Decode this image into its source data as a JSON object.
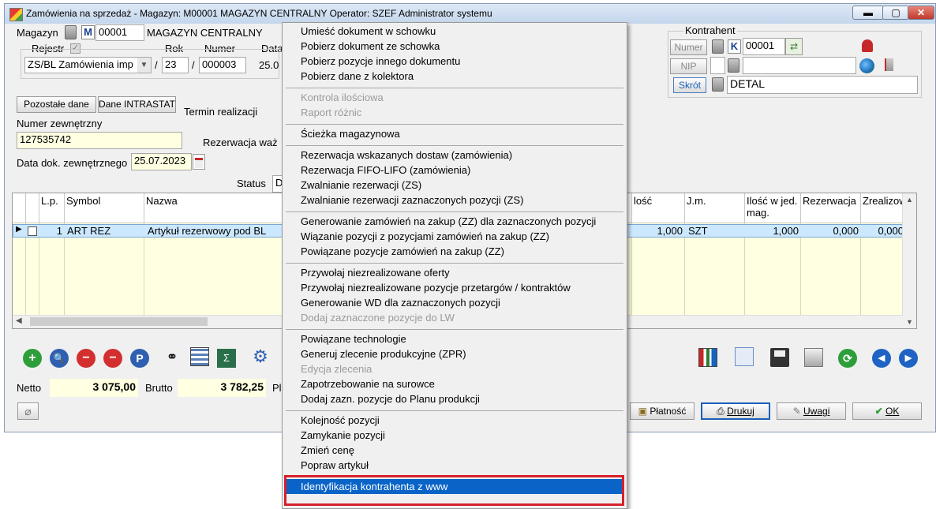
{
  "window": {
    "title": "Zamówienia na sprzedaż - Magazyn: M00001 MAGAZYN CENTRALNY  Operator: SZEF Administrator systemu"
  },
  "header": {
    "magazyn_label": "Magazyn",
    "magazyn_code_prefix": "M",
    "magazyn_code": "00001",
    "magazyn_name": "MAGAZYN CENTRALNY",
    "rejestr_label": "Rejestr",
    "rok_label": "Rok",
    "numer_label": "Numer",
    "data_label": "Data",
    "rejestr_value": "ZS/BL Zamówienia imp",
    "slash1": "/",
    "rok_value": "23",
    "slash2": "/",
    "numer_value": "000003",
    "data_value": "25.0"
  },
  "tabs": {
    "pozostale": "Pozostałe dane",
    "intrastat": "Dane INTRASTAT"
  },
  "termin_label": "Termin realizacji",
  "numer_zewn_label": "Numer zewnętrzny",
  "numer_zewn_value": "127535742",
  "rezerwacja_label": "Rezerwacja  waż",
  "data_dok_label": "Data dok. zewnętrznego",
  "data_dok_value": "25.07.2023",
  "status_label": "Status",
  "status_value": "D",
  "kontrahent": {
    "group_label": "Kontrahent",
    "numer_btn": "Numer",
    "nip_btn": "NIP",
    "skrot_btn": "Skrót",
    "code_prefix": "K",
    "code": "00001",
    "skrot_value": "DETAL"
  },
  "grid": {
    "headers": {
      "lp": "L.p.",
      "symbol": "Symbol",
      "nazwa": "Nazwa",
      "ilosc": "lość",
      "jm": "J.m.",
      "ilosc_jed": "Ilość w jed.\nmag.",
      "rezerwacja": "Rezerwacja",
      "zrealizowano": "Zrealizowa"
    },
    "row": {
      "lp": "1",
      "symbol": "ART REZ",
      "nazwa": "Artykuł rezerwowy pod BL",
      "ilosc": "1,000",
      "jm": "SZT",
      "ilosc_jed": "1,000",
      "rezerwacja": "0,000",
      "zrealizowano": "0,000"
    }
  },
  "totals": {
    "netto_label": "Netto",
    "netto_value": "3 075,00",
    "brutto_label": "Brutto",
    "brutto_value": "3 782,25",
    "pl_label": "Pl"
  },
  "buttons": {
    "platnosc": "Płatność",
    "drukuj": "Drukuj",
    "uwagi": "Uwagi",
    "ok": "OK"
  },
  "menu": {
    "items": [
      "Umieść dokument w schowku",
      "Pobierz dokument ze schowka",
      "Pobierz pozycje innego dokumentu",
      "Pobierz dane z kolektora",
      "Kontrola ilościowa",
      "Raport różnic",
      "Ścieżka magazynowa",
      "Rezerwacja wskazanych dostaw (zamówienia)",
      "Rezerwacja FIFO-LIFO (zamówienia)",
      "Zwalnianie rezerwacji (ZS)",
      "Zwalnianie rezerwacji zaznaczonych pozycji (ZS)",
      "Generowanie zamówień na zakup (ZZ) dla zaznaczonych pozycji",
      "Wiązanie pozycji z pozycjami zamówień na zakup (ZZ)",
      "Powiązane pozycje zamówień na zakup (ZZ)",
      "Przywołaj niezrealizowane oferty",
      "Przywołaj niezrealizowane pozycje przetargów / kontraktów",
      "Generowanie WD dla zaznaczonych pozycji",
      "Dodaj zaznaczone pozycje do LW",
      "Powiązane technologie",
      "Generuj zlecenie produkcyjne (ZPR)",
      "Edycja zlecenia",
      "Zapotrzebowanie na surowce",
      "Dodaj zazn. pozycje do Planu produkcji",
      "Kolejność pozycji",
      "Zamykanie pozycji",
      "Zmień cenę",
      "Popraw artykuł",
      "Identyfikacja kontrahenta z www"
    ]
  }
}
